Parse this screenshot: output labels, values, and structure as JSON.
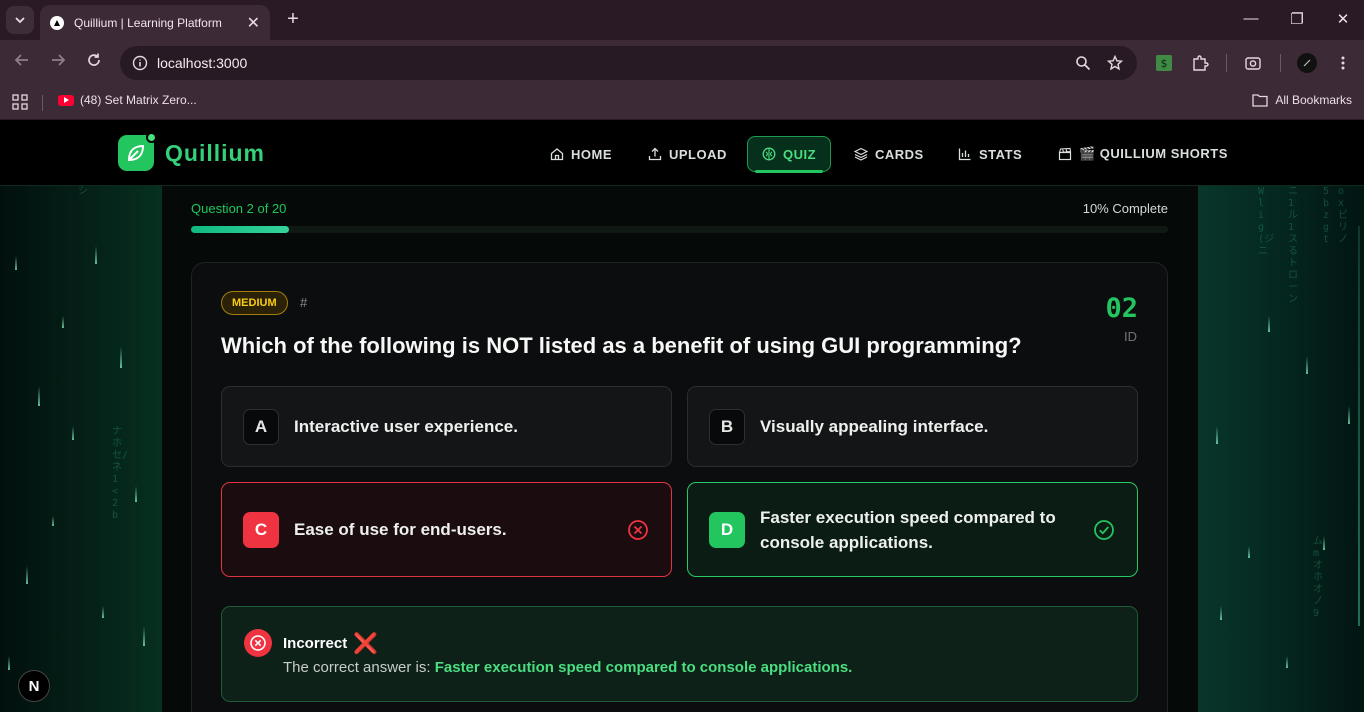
{
  "browser": {
    "tab_title": "Quillium | Learning Platform",
    "tab_close": "✕",
    "new_tab": "+",
    "url": "localhost:3000",
    "bookmark_item": "(48) Set Matrix Zero...",
    "all_bookmarks": "All Bookmarks",
    "window_controls": [
      "—",
      "❐",
      "✕"
    ]
  },
  "nav": {
    "brand": "Quillium",
    "items": [
      {
        "label": "HOME",
        "icon": "home-icon"
      },
      {
        "label": "UPLOAD",
        "icon": "upload-icon"
      },
      {
        "label": "QUIZ",
        "icon": "brain-icon",
        "active": true
      },
      {
        "label": "CARDS",
        "icon": "layers-icon"
      },
      {
        "label": "STATS",
        "icon": "bar-chart-icon"
      },
      {
        "label": "🎬 QUILLIUM SHORTS",
        "icon": "clapperboard-icon"
      }
    ]
  },
  "progress": {
    "question_label": "Question 2 of 20",
    "percent_label": "10% Complete",
    "percent": 10
  },
  "quiz": {
    "difficulty": "MEDIUM",
    "hash": "#",
    "id": "02",
    "id_label": "ID",
    "question": "Which of the following is NOT listed as a benefit of using GUI programming?",
    "options": [
      {
        "letter": "A",
        "text": "Interactive user experience.",
        "state": "neutral"
      },
      {
        "letter": "B",
        "text": "Visually appealing interface.",
        "state": "neutral"
      },
      {
        "letter": "C",
        "text": "Ease of use for end-users.",
        "state": "wrong"
      },
      {
        "letter": "D",
        "text": "Faster execution speed compared to console applications.",
        "state": "correct"
      }
    ]
  },
  "result": {
    "title": "Incorrect",
    "title_mark": "❌",
    "prefix": "The correct answer is: ",
    "answer": "Faster execution speed compared to console applications."
  },
  "dev_badge": "N",
  "colors": {
    "accent": "#22c55e",
    "wrong": "#ef3340",
    "medium": "#facc15"
  }
}
